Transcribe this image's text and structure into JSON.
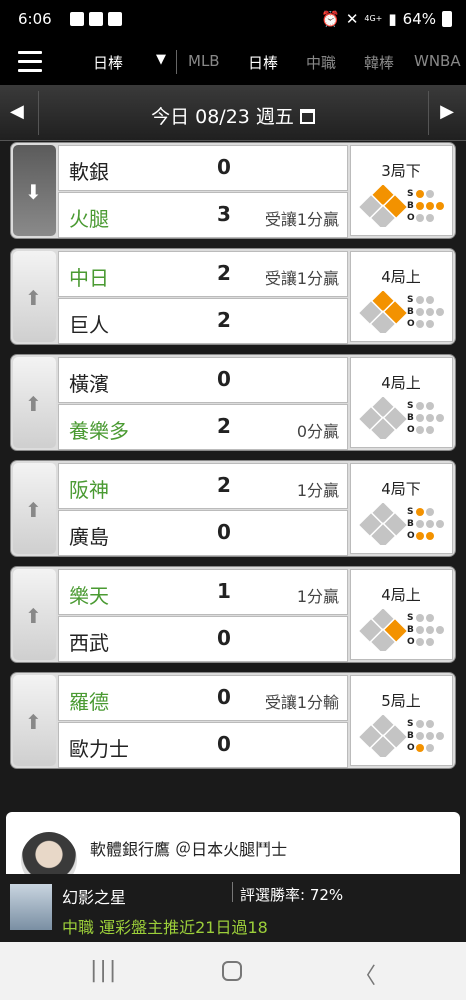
{
  "status": {
    "time": "6:06",
    "battery": "64%",
    "net": "4G+"
  },
  "header": {
    "league_select": "日棒",
    "tabs": [
      "MLB",
      "日棒",
      "中職",
      "韓棒",
      "WNBA"
    ],
    "active_tab": "日棒"
  },
  "date": {
    "label": "今日 08/23 週五"
  },
  "games": [
    {
      "dir": "down",
      "team1": "軟銀",
      "score1": "0",
      "note1": "",
      "green1": false,
      "team2": "火腿",
      "score2": "3",
      "note2": "受讓1分贏",
      "green2": true,
      "inning": "3局下",
      "bases": [
        1,
        1,
        0
      ],
      "strikes": 1,
      "balls": 3,
      "outs": 0
    },
    {
      "dir": "up",
      "team1": "中日",
      "score1": "2",
      "note1": "受讓1分贏",
      "green1": true,
      "team2": "巨人",
      "score2": "2",
      "note2": "",
      "green2": false,
      "inning": "4局上",
      "bases": [
        1,
        1,
        0
      ],
      "strikes": 0,
      "balls": 0,
      "outs": 0
    },
    {
      "dir": "up",
      "team1": "橫濱",
      "score1": "0",
      "note1": "",
      "green1": false,
      "team2": "養樂多",
      "score2": "2",
      "note2": "0分贏",
      "green2": true,
      "inning": "4局上",
      "bases": [
        0,
        0,
        0
      ],
      "strikes": 0,
      "balls": 0,
      "outs": 0
    },
    {
      "dir": "up",
      "team1": "阪神",
      "score1": "2",
      "note1": "1分贏",
      "green1": true,
      "team2": "廣島",
      "score2": "0",
      "note2": "",
      "green2": false,
      "inning": "4局下",
      "bases": [
        0,
        0,
        0
      ],
      "strikes": 1,
      "balls": 0,
      "outs": 2
    },
    {
      "dir": "up",
      "team1": "樂天",
      "score1": "1",
      "note1": "1分贏",
      "green1": true,
      "team2": "西武",
      "score2": "0",
      "note2": "",
      "green2": false,
      "inning": "4局上",
      "bases": [
        1,
        0,
        0
      ],
      "strikes": 0,
      "balls": 0,
      "outs": 0
    },
    {
      "dir": "up",
      "team1": "羅德",
      "score1": "0",
      "note1": "受讓1分輸",
      "green1": true,
      "team2": "歐力士",
      "score2": "0",
      "note2": "",
      "green2": false,
      "inning": "5局上",
      "bases": [
        0,
        0,
        0
      ],
      "strikes": 0,
      "balls": 0,
      "outs": 1
    }
  ],
  "forum": {
    "text": "軟體銀行鷹 ＠日本火腿鬥士"
  },
  "ticker": {
    "name": "幻影之星",
    "rate": "評選勝率: 72%",
    "post": "中職 運彩盤主推近21日過18"
  },
  "colors": {
    "accent": "#f39200",
    "win_green": "#4a9a32"
  }
}
